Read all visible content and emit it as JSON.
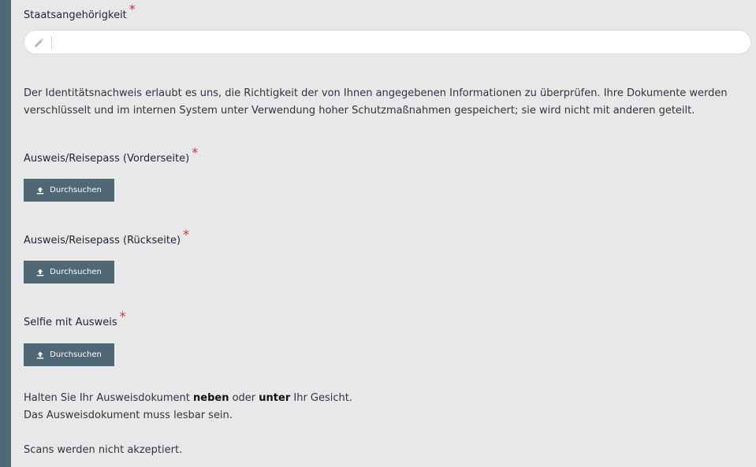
{
  "nationality": {
    "label": "Staatsangehörigkeit",
    "required_mark": "*",
    "value": "",
    "placeholder": "",
    "icon": "pencil-icon"
  },
  "info_text": "Der Identitätsnachweis erlaubt es uns, die Richtigkeit der von Ihnen angegebenen Informationen zu überprüfen. Ihre Dokumente werden verschlüsselt und im internen System unter Verwendung hoher Schutzmaßnahmen gespeichert; sie wird nicht mit anderen geteilt.",
  "uploads": [
    {
      "label": "Ausweis/Reisepass (Vorderseite)",
      "required_mark": "*",
      "button_label": "Durchsuchen",
      "icon": "upload-icon"
    },
    {
      "label": "Ausweis/Reisepass (Rückseite)",
      "required_mark": "*",
      "button_label": "Durchsuchen",
      "icon": "upload-icon"
    },
    {
      "label": "Selfie mit Ausweis",
      "required_mark": "*",
      "button_label": "Durchsuchen",
      "icon": "upload-icon"
    }
  ],
  "hints": {
    "line1_a": "Halten Sie Ihr Ausweisdokument ",
    "line1_b": "neben",
    "line1_c": " oder ",
    "line1_d": "unter",
    "line1_e": " Ihr Gesicht.",
    "line2": "Das Ausweisdokument muss lesbar sein.",
    "line3": "Scans werden nicht akzeptiert."
  },
  "colors": {
    "accent": "#4e6876",
    "required": "#e02b2b",
    "background": "#e8e8e8"
  }
}
